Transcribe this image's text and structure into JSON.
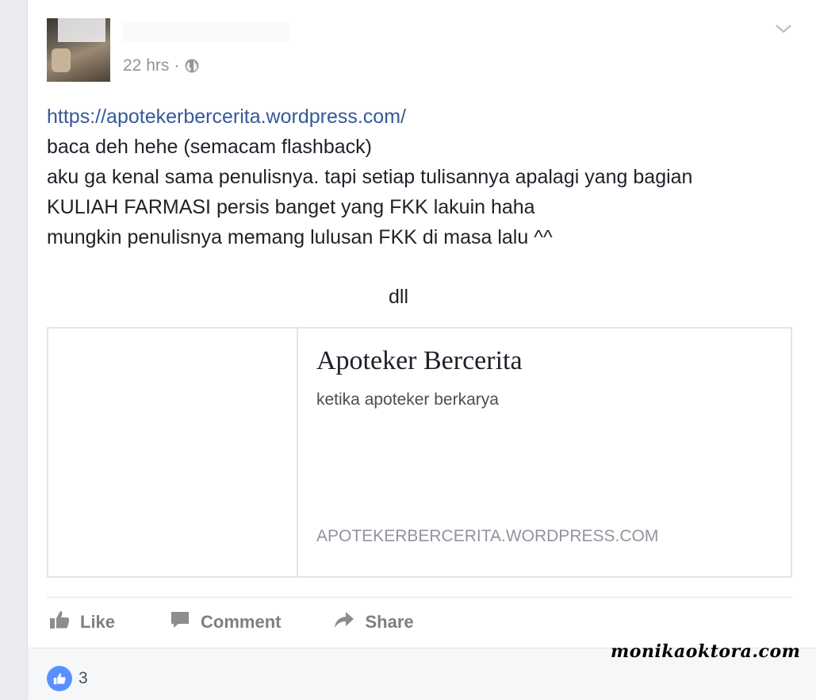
{
  "post": {
    "timestamp": "22 hrs",
    "separator": "·",
    "audience_icon": "globe-icon",
    "menu_icon": "chevron-down-icon",
    "link_url": "https://apotekerbercerita.wordpress.com/",
    "lines": [
      "baca deh hehe (semacam flashback)",
      "aku ga kenal sama penulisnya. tapi setiap tulisannya apalagi yang bagian",
      "KULIAH FARMASI persis banget yang FKK lakuin haha",
      "mungkin penulisnya memang lulusan FKK di masa lalu ^^"
    ],
    "tail_text": "dll"
  },
  "link_preview": {
    "title": "Apoteker Bercerita",
    "description": "ketika apoteker berkarya",
    "domain": "APOTEKERBERCERITA.WORDPRESS.COM"
  },
  "actions": {
    "like": "Like",
    "comment": "Comment",
    "share": "Share"
  },
  "reactions": {
    "count": "3",
    "icon": "thumbs-up-icon"
  },
  "watermark": "monikaoktora.com",
  "colors": {
    "link": "#365899",
    "text": "#1d2129",
    "meta": "#90949c",
    "action": "#7f7f7f",
    "like_badge": "#5890ff"
  }
}
